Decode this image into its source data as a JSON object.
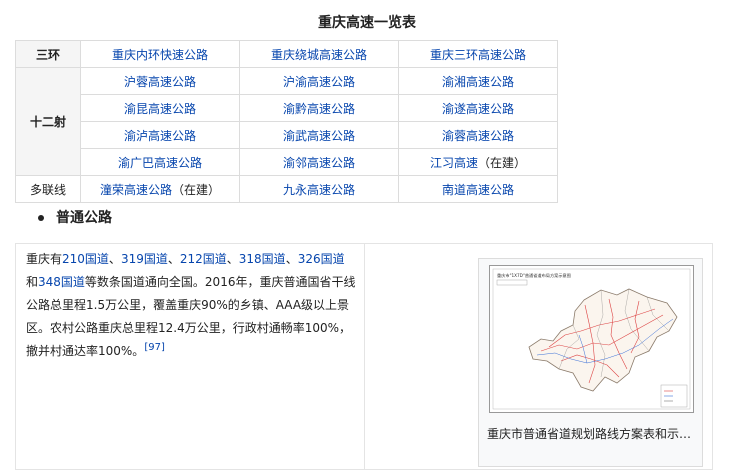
{
  "title": "重庆高速一览表",
  "rows": {
    "ring": {
      "label": "三环",
      "cells": [
        "重庆内环快速公路",
        "重庆绕城高速公路",
        "重庆三环高速公路"
      ]
    },
    "radial": {
      "label": "十二射",
      "r1": [
        "沪蓉高速公路",
        "沪渝高速公路",
        "渝湘高速公路"
      ],
      "r2": [
        "渝昆高速公路",
        "渝黔高速公路",
        "渝遂高速公路"
      ],
      "r3": [
        "渝泸高速公路",
        "渝武高速公路",
        "渝蓉高速公路"
      ],
      "r4": [
        "渝广巴高速公路",
        "渝邻高速公路",
        "江习高速"
      ],
      "r4_note": "（在建）"
    },
    "multi": {
      "label": "多联线",
      "cells": [
        "潼荣高速公路",
        "九永高速公路",
        "南道高速公路"
      ],
      "note": "（在建）"
    }
  },
  "section": {
    "heading": "普通公路"
  },
  "paragraph": {
    "t1": "重庆有",
    "l1": "210国道",
    "sep1": "、",
    "l2": "319国道",
    "sep2": "、",
    "l3": "212国道",
    "sep3": "、",
    "l4": "318国道",
    "sep4": "、",
    "l5": "326国道",
    "t2": "和",
    "l6": "348国道",
    "t3": "等数条国道通向全国。2016年，重庆普通国省干线公路总里程1.5万公里，覆盖重庆90%的乡镇、AAA级以上景区。农村公路重庆总里程12.4万公里，行政村通畅率100%，撤并村通达率100%。",
    "ref": "[97]"
  },
  "figure": {
    "caption": "重庆市普通省道规划路线方案表和示…",
    "map_title": "重庆市\"1X7D\"普通省道布局方案示意图"
  },
  "colors": {
    "link": "#0645ad",
    "border": "#dcdcdc",
    "header_bg": "#f5f5f5"
  }
}
